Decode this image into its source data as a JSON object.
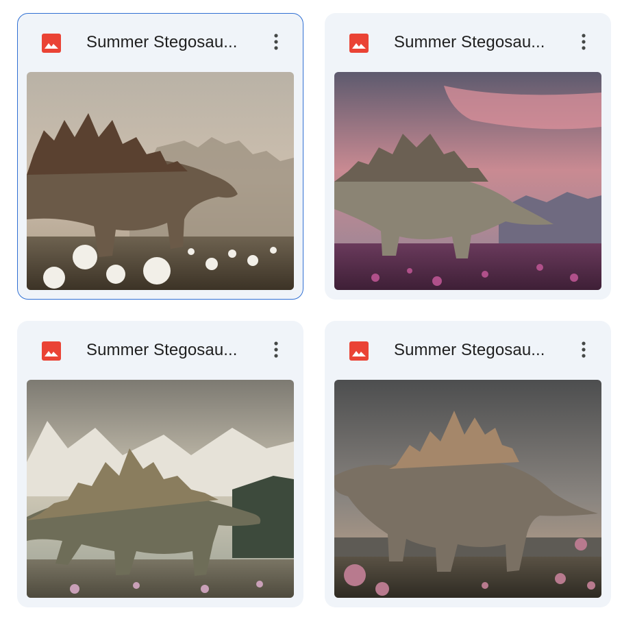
{
  "files": [
    {
      "title": "Summer Stegosau...",
      "file_type_icon": "image-icon",
      "menu_icon": "more-vert-icon",
      "selected": true,
      "thumbnail": "stegosaurus in misty meadow with white flowers"
    },
    {
      "title": "Summer Stegosau...",
      "file_type_icon": "image-icon",
      "menu_icon": "more-vert-icon",
      "selected": false,
      "thumbnail": "stegosaurus at pink sunset over purple flower field"
    },
    {
      "title": "Summer Stegosau...",
      "file_type_icon": "image-icon",
      "menu_icon": "more-vert-icon",
      "selected": false,
      "thumbnail": "stegosaurus walking before snowy mountains"
    },
    {
      "title": "Summer Stegosau...",
      "file_type_icon": "image-icon",
      "menu_icon": "more-vert-icon",
      "selected": false,
      "thumbnail": "stegosaurus under dusky sky with pink flowers"
    }
  ],
  "colors": {
    "card_background": "#f0f4f9",
    "selected_border": "#2f6fd3",
    "image_icon": "#ea4335",
    "title_text": "#1f1f1f",
    "menu_icon": "#444746"
  }
}
